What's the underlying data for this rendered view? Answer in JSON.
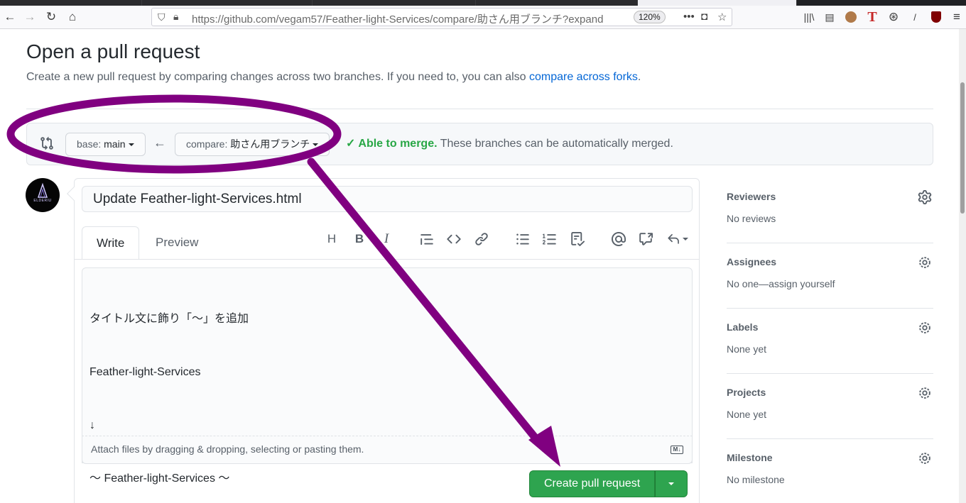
{
  "browser": {
    "url": "https://github.com/vegam57/Feather-light-Services/compare/助さん用ブランチ?expand",
    "zoom": "120%",
    "nav_icons": [
      "back-icon",
      "forward-icon",
      "reload-icon",
      "home-icon"
    ],
    "extension_icons": [
      "library-icon",
      "sidebar-icon",
      "avatar-extension-icon",
      "text-extension-icon",
      "steering-extension-icon",
      "slash-extension-icon",
      "ublock-icon",
      "menu-icon"
    ]
  },
  "page": {
    "title": "Open a pull request",
    "description": "Create a new pull request by comparing changes across two branches. If you need to, you can also ",
    "forks_link": "compare across forks",
    "description_end": "."
  },
  "range": {
    "base_prefix": "base:",
    "base_branch": "main",
    "compare_prefix": "compare:",
    "compare_branch": "助さん用ブランチ",
    "merge_ok": "Able to merge.",
    "merge_text": "These branches can be automatically merged."
  },
  "avatar": {
    "label": "ELDERIU"
  },
  "composer": {
    "title_value": "Update Feather-light-Services.html",
    "tabs": {
      "write": "Write",
      "preview": "Preview"
    },
    "toolbar_icons": [
      "heading-icon",
      "bold-icon",
      "italic-icon",
      "quote-icon",
      "code-icon",
      "link-icon",
      "bulleted-list-icon",
      "numbered-list-icon",
      "task-list-icon",
      "mention-icon",
      "reference-icon",
      "reply-icon"
    ],
    "body_lines": [
      "タイトル文に飾り「〜」を追加",
      "Feather-light-Services",
      "↓",
      "〜 Feather-light-Services 〜"
    ],
    "attach_text": "Attach files by dragging & dropping, selecting or pasting them.",
    "submit_label": "Create pull request"
  },
  "sidebar": [
    {
      "heading": "Reviewers",
      "value": "No reviews"
    },
    {
      "heading": "Assignees",
      "value": "No one—assign yourself"
    },
    {
      "heading": "Labels",
      "value": "None yet"
    },
    {
      "heading": "Projects",
      "value": "None yet"
    },
    {
      "heading": "Milestone",
      "value": "No milestone"
    }
  ],
  "colors": {
    "annotation": "#800080",
    "link": "#0366d6",
    "success": "#28a745",
    "primary_button": "#2ea44f"
  }
}
